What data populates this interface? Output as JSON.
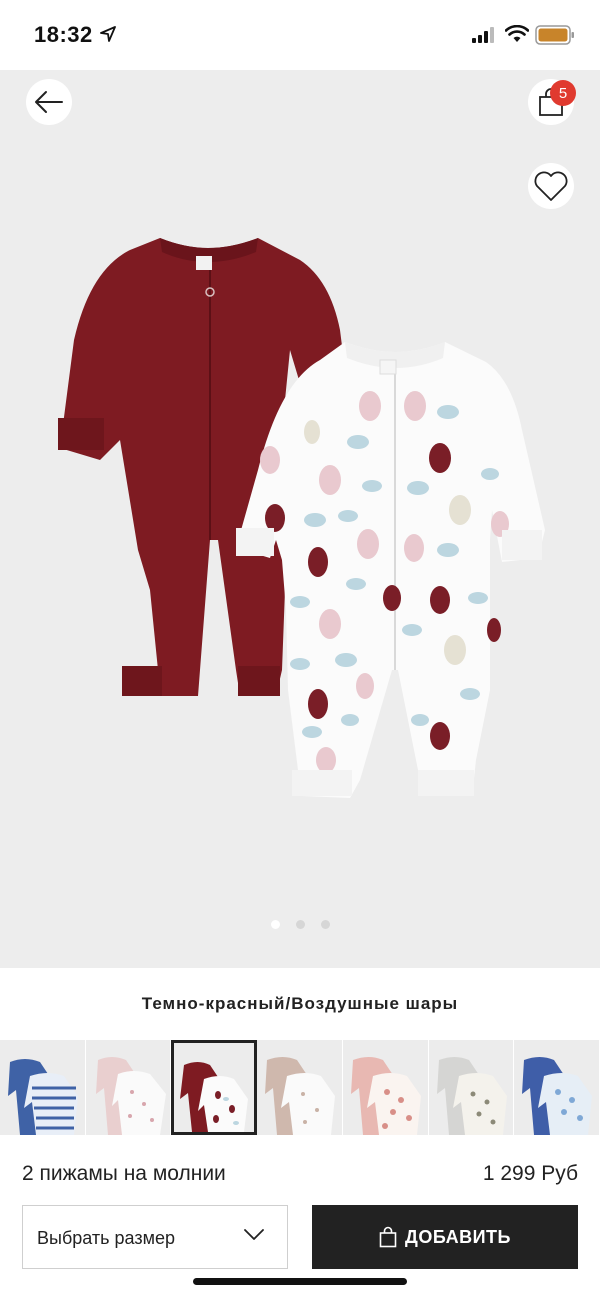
{
  "status_bar": {
    "time": "18:32",
    "icons": [
      "location-arrow-icon",
      "signal-icon",
      "wifi-icon",
      "battery-icon"
    ],
    "battery_color": "#c8842a"
  },
  "header": {
    "back_icon": "arrow-left-icon",
    "bag_icon": "shopping-bag-icon",
    "bag_count": "5",
    "favorite_icon": "heart-icon",
    "badge_color": "#e03a2f"
  },
  "gallery": {
    "image_count": 3,
    "active_index": 0
  },
  "color_name": "Темно-красный/Воздушные шары",
  "thumbnails": [
    {
      "name": "blue-stripes",
      "selected": false
    },
    {
      "name": "pink-white",
      "selected": false
    },
    {
      "name": "dark-red-balloons",
      "selected": true
    },
    {
      "name": "beige-white",
      "selected": false
    },
    {
      "name": "pink-floral",
      "selected": false
    },
    {
      "name": "grey-print",
      "selected": false
    },
    {
      "name": "blue-print",
      "selected": false
    }
  ],
  "product": {
    "name": "2 пижамы на молнии",
    "price": "1 299 Руб"
  },
  "size_select": {
    "label": "Выбрать размер"
  },
  "add_button": {
    "label": "ДОБАВИТЬ"
  }
}
